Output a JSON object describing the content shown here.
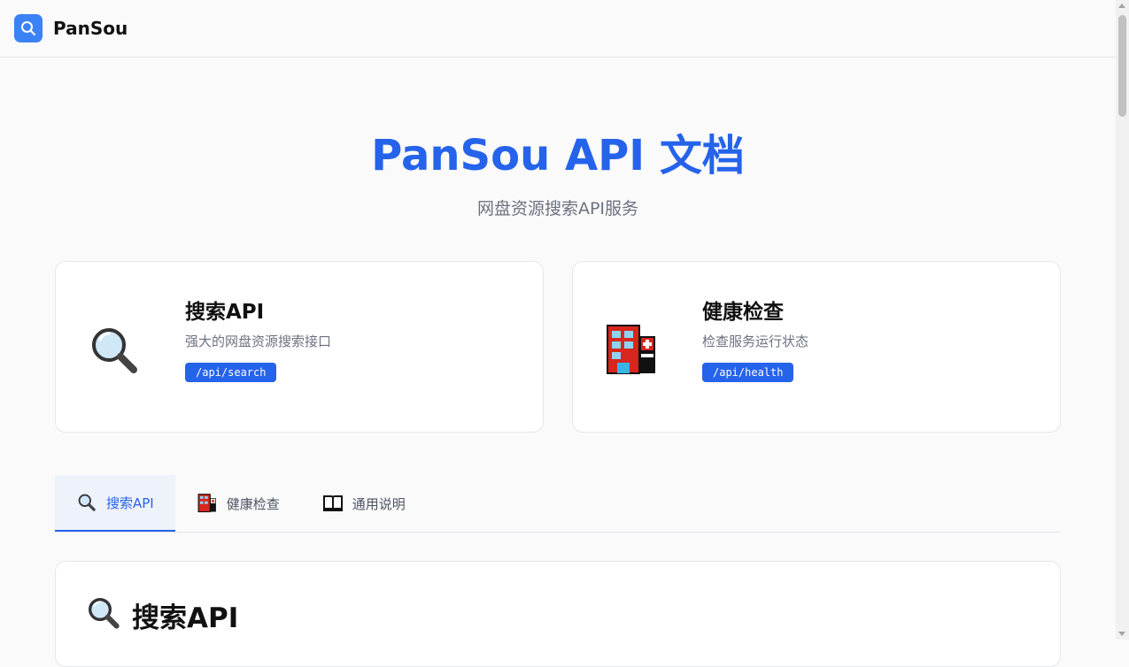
{
  "header": {
    "brand": "PanSou",
    "logo_icon": "search-icon",
    "accent": "#3b82f6"
  },
  "hero": {
    "title": "PanSou API 文档",
    "subtitle": "网盘资源搜索API服务",
    "color": "#2563eb"
  },
  "cards": [
    {
      "title": "搜索API",
      "description": "强大的网盘资源搜索接口",
      "endpoint": "/api/search",
      "icon": "magnifier-icon"
    },
    {
      "title": "健康检查",
      "description": "检查服务运行状态",
      "endpoint": "/api/health",
      "icon": "hospital-icon"
    }
  ],
  "tabs": [
    {
      "label": "搜索API",
      "icon": "magnifier-icon",
      "active": true
    },
    {
      "label": "健康检查",
      "icon": "hospital-icon",
      "active": false
    },
    {
      "label": "通用说明",
      "icon": "book-icon",
      "active": false
    }
  ],
  "section": {
    "title": "搜索API",
    "icon": "magnifier-icon"
  }
}
